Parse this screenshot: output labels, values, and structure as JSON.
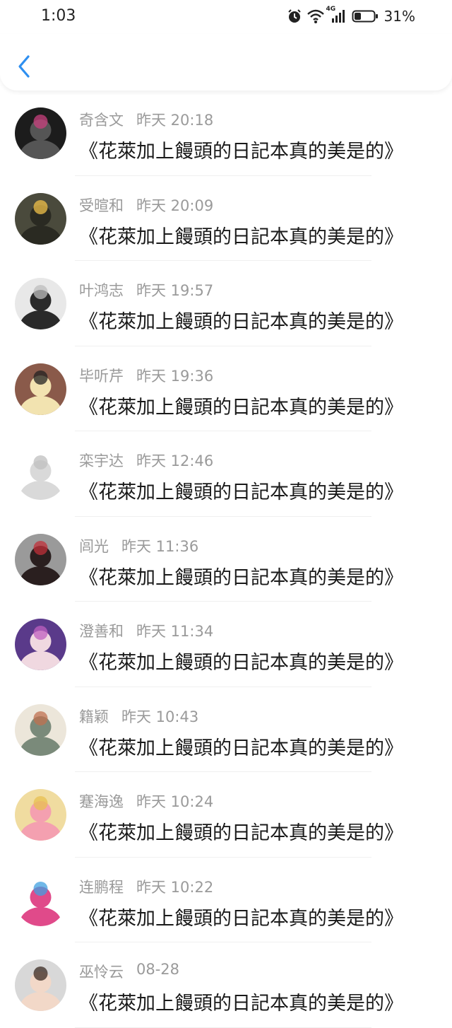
{
  "status_bar": {
    "time": "1:03",
    "network": "4G",
    "battery": "31%"
  },
  "header": {
    "back_icon": "chevron-left-icon",
    "accent_color": "#2e8ff0"
  },
  "comments": [
    {
      "name": "奇含文",
      "time": "昨天 20:18",
      "text": "《花萊加上饅頭的日記本真的美是的》",
      "avatar_bg": "#1c1c1c",
      "avatar_fg": "#555555",
      "avatar_accent": "#c8407e"
    },
    {
      "name": "受暄和",
      "time": "昨天 20:09",
      "text": "《花萊加上饅頭的日記本真的美是的》",
      "avatar_bg": "#4a4a3c",
      "avatar_fg": "#2a2a22",
      "avatar_accent": "#f2c14a"
    },
    {
      "name": "叶鸿志",
      "time": "昨天 19:57",
      "text": "《花萊加上饅頭的日記本真的美是的》",
      "avatar_bg": "#e8e8e8",
      "avatar_fg": "#2a2a2a",
      "avatar_accent": "#bdbdbd"
    },
    {
      "name": "毕听芹",
      "time": "昨天 19:36",
      "text": "《花萊加上饅頭的日記本真的美是的》",
      "avatar_bg": "#8a5a4a",
      "avatar_fg": "#f2e3b0",
      "avatar_accent": "#222222"
    },
    {
      "name": "栾宇达",
      "time": "昨天 12:46",
      "text": "《花萊加上饅頭的日記本真的美是的》",
      "avatar_bg": "#ffffff",
      "avatar_fg": "#d9d9d9",
      "avatar_accent": "#bfbfbf"
    },
    {
      "name": "闾光",
      "time": "昨天 11:36",
      "text": "《花萊加上饅頭的日記本真的美是的》",
      "avatar_bg": "#9a9a9a",
      "avatar_fg": "#2a1f1f",
      "avatar_accent": "#c0303a"
    },
    {
      "name": "澄善和",
      "time": "昨天 11:34",
      "text": "《花萊加上饅頭的日記本真的美是的》",
      "avatar_bg": "#5a3a8a",
      "avatar_fg": "#f0d8e0",
      "avatar_accent": "#c060c0"
    },
    {
      "name": "籍颖",
      "time": "昨天 10:43",
      "text": "《花萊加上饅頭的日記本真的美是的》",
      "avatar_bg": "#ece6da",
      "avatar_fg": "#7a8a7a",
      "avatar_accent": "#c07050"
    },
    {
      "name": "蹇海逸",
      "time": "昨天 10:24",
      "text": "《花萊加上饅頭的日記本真的美是的》",
      "avatar_bg": "#f0dca0",
      "avatar_fg": "#f4a0b0",
      "avatar_accent": "#e8c050"
    },
    {
      "name": "连鹏程",
      "time": "昨天 10:22",
      "text": "《花萊加上饅頭的日記本真的美是的》",
      "avatar_bg": "#ffffff",
      "avatar_fg": "#e04a8a",
      "avatar_accent": "#40a0e0"
    },
    {
      "name": "巫怜云",
      "time": "08-28",
      "text": "《花萊加上饅頭的日記本真的美是的》",
      "avatar_bg": "#d8d8d8",
      "avatar_fg": "#f2d8c8",
      "avatar_accent": "#3a2a22"
    }
  ]
}
